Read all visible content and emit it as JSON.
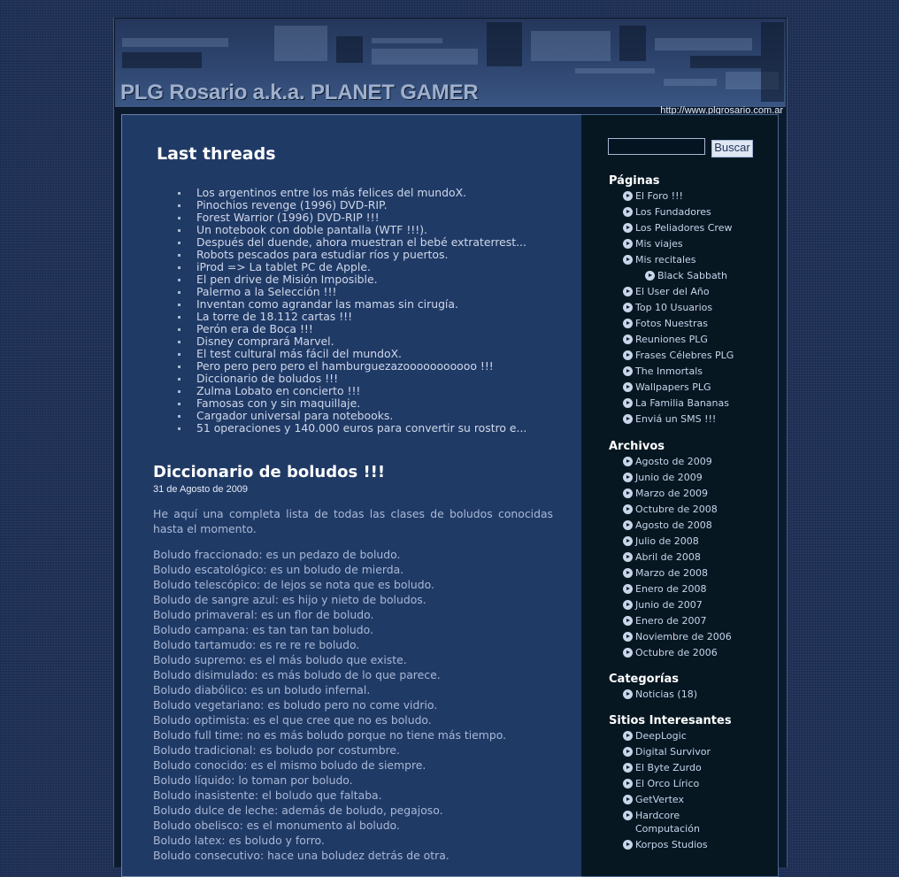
{
  "header": {
    "title": "PLG Rosario a.k.a. PLANET GAMER",
    "url": "http://www.plgrosario.com.ar"
  },
  "main": {
    "last_threads": {
      "heading": "Last threads",
      "items": [
        "Los argentinos entre los más felices del mundoX.",
        "Pinochios revenge (1996) DVD-RIP.",
        "Forest Warrior (1996) DVD-RIP !!!",
        "Un notebook con doble pantalla (WTF !!!).",
        "Después del duende, ahora muestran el bebé extraterrest...",
        "Robots pescados para estudiar ríos y puertos.",
        "iProd => La tablet PC de Apple.",
        "El pen drive de Misión Imposible.",
        "Palermo a la Selección !!!",
        "Inventan como agrandar las mamas sin cirugía.",
        "La torre de 18.112 cartas !!!",
        "Perón era de Boca !!!",
        "Disney comprará Marvel.",
        "El test cultural más fácil del mundoX.",
        "Pero pero pero pero el hamburguezazooooooooooo !!!",
        "Diccionario de boludos !!!",
        "Zulma Lobato en concierto !!!",
        "Famosas con y sin maquillaje.",
        "Cargador universal para notebooks.",
        "51 operaciones y 140.000 euros para convertir su rostro e..."
      ]
    },
    "post": {
      "title": "Diccionario de boludos !!!",
      "date": "31 de Agosto de 2009",
      "intro": "He aquí una completa lista de todas las clases de boludos conocidas hasta el momento.",
      "lines": [
        "Boludo fraccionado: es un pedazo de boludo.",
        "Boludo escatológico: es un boludo de mierda.",
        "Boludo telescópico: de lejos se nota que es boludo.",
        "Boludo de sangre azul: es hijo y nieto de boludos.",
        "Boludo primaveral: es un flor de boludo.",
        "Boludo campana: es tan tan tan boludo.",
        "Boludo tartamudo: es re re re boludo.",
        "Boludo supremo: es el más boludo que existe.",
        "Boludo disimulado: es más boludo de lo que parece.",
        "Boludo diabólico: es un boludo infernal.",
        "Boludo vegetariano: es boludo pero no come vidrio.",
        "Boludo optimista: es el que cree que no es boludo.",
        "Boludo full time: no es más boludo porque no tiene más tiempo.",
        "Boludo tradicional: es boludo por costumbre.",
        "Boludo conocido: es el mismo boludo de siempre.",
        "Boludo líquido: lo toman por boludo.",
        "Boludo inasistente: el boludo que faltaba.",
        "Boludo dulce de leche: además de boludo, pegajoso.",
        "Boludo obelisco: es el monumento al boludo.",
        "Boludo latex: es boludo y forro.",
        "Boludo consecutivo: hace una boludez detrás de otra."
      ]
    }
  },
  "sidebar": {
    "search": {
      "placeholder": "",
      "button_label": "Buscar"
    },
    "paginas": {
      "heading": "Páginas",
      "items": [
        {
          "label": "El Foro !!!"
        },
        {
          "label": "Los Fundadores"
        },
        {
          "label": "Los Peliadores Crew"
        },
        {
          "label": "Mis viajes"
        },
        {
          "label": "Mis recitales"
        },
        {
          "label": "Black Sabbath",
          "sub": true
        },
        {
          "label": "El User del Año"
        },
        {
          "label": "Top 10 Usuarios"
        },
        {
          "label": "Fotos Nuestras"
        },
        {
          "label": "Reuniones PLG"
        },
        {
          "label": "Frases Célebres PLG"
        },
        {
          "label": "The Inmortals"
        },
        {
          "label": "Wallpapers PLG"
        },
        {
          "label": "La Familia Bananas"
        },
        {
          "label": "Enviá un SMS !!!"
        }
      ]
    },
    "archivos": {
      "heading": "Archivos",
      "items": [
        "Agosto de 2009",
        "Junio de 2009",
        "Marzo de 2009",
        "Octubre de 2008",
        "Agosto de 2008",
        "Julio de 2008",
        "Abril de 2008",
        "Marzo de 2008",
        "Enero de 2008",
        "Junio de 2007",
        "Enero de 2007",
        "Noviembre de 2006",
        "Octubre de 2006"
      ]
    },
    "categorias": {
      "heading": "Categorías",
      "items": [
        "Noticias (18)"
      ]
    },
    "sitios": {
      "heading": "Sitios Interesantes",
      "items": [
        "DeepLogic",
        "Digital Survivor",
        "El Byte Zurdo",
        "El Orco Lírico",
        "GetVertex",
        "Hardcore Computación",
        "Korpos Studios"
      ]
    }
  }
}
